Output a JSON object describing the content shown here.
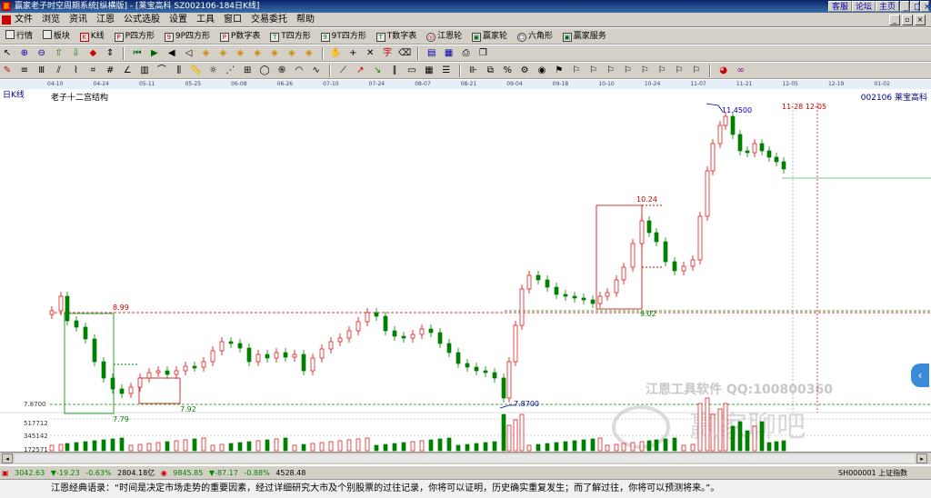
{
  "window": {
    "title": "赢家老子时空周期系统[纵横版] - [莱宝高科   SZ002106-184日K线]",
    "logo_text": "赢",
    "top_buttons": [
      "客服",
      "论坛",
      "主页"
    ]
  },
  "menu": [
    "文件",
    "浏览",
    "资讯",
    "江恩",
    "公式选股",
    "设置",
    "工具",
    "窗口",
    "交易委托",
    "帮助"
  ],
  "toolbar1": [
    {
      "label": "行情",
      "icon": "grid-icon"
    },
    {
      "label": "板块",
      "icon": "blocks-icon"
    },
    {
      "label": "K线",
      "icon": "kline-icon"
    },
    {
      "label": "P四方形",
      "icon": "square-p-icon"
    },
    {
      "label": "9P四方形",
      "icon": "square-9p-icon"
    },
    {
      "label": "P数字表",
      "icon": "table-p-icon"
    },
    {
      "label": "T四方形",
      "icon": "square-t-icon"
    },
    {
      "label": "9T四方形",
      "icon": "square-9t-icon"
    },
    {
      "label": "T数字表",
      "icon": "table-t-icon"
    },
    {
      "label": "江恩轮",
      "icon": "gann-wheel-icon"
    },
    {
      "label": "赢家轮",
      "icon": "winner-wheel-icon"
    },
    {
      "label": "六角形",
      "icon": "hexagon-icon"
    },
    {
      "label": "赢家服务",
      "icon": "service-icon"
    }
  ],
  "chart_header": {
    "period_label": "日K线",
    "subtitle": "老子十二宫结构",
    "right_title": "002106  莱宝高科"
  },
  "date_axis": [
    "04-10",
    "04-24",
    "05-11",
    "05-25",
    "06-08",
    "06-26",
    "07-10",
    "07-24",
    "08-07",
    "08-21",
    "09-04",
    "09-18",
    "10-10",
    "10-24",
    "11-07",
    "11-21",
    "12-05",
    "12-19",
    "01-02"
  ],
  "annotations": {
    "high": "11.4500",
    "low": "7.8700",
    "level_899": "8.99",
    "level_779": "7.79",
    "level_792": "7.92",
    "level_1024": "10.24",
    "level_902": "9.02",
    "date_range": "11-28 12-05",
    "y_axis_7870": "7.8700",
    "vol_labels": [
      "517712",
      "345142",
      "172571"
    ],
    "watermark1": "江恩工具软件  QQ:100800360",
    "watermark2": "赢家聊吧"
  },
  "statusbar": {
    "sh_index": "3042.63",
    "sh_change": "▼-19.23",
    "sh_pct": "-0.63%",
    "sh_amount": "2804.18亿",
    "sz_index": "9845.85",
    "sz_change": "▼-87.17",
    "sz_pct": "-0.88%",
    "sz_amount": "4528.48",
    "right_code": "SH000001 上证指数"
  },
  "quote": "江恩经典语录：“时间是决定市场走势的重要因素，经过详细研究大市及个别股票的过往记录，你将可以证明，历史确实重复发生；而了解过往，你将可以预测将来。”。",
  "colors": {
    "up": "#e00000",
    "down": "#008000",
    "title_bg": "#0a246a",
    "face": "#d4d0c8"
  }
}
